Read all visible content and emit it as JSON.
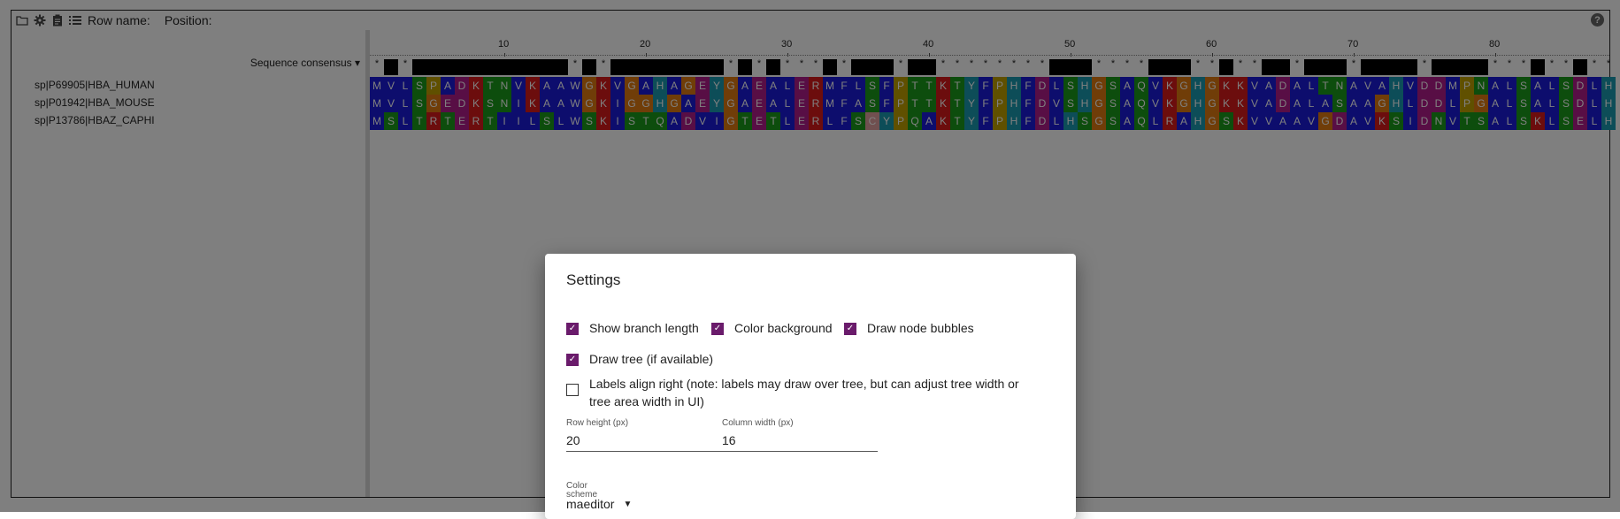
{
  "toolbar": {
    "icons": [
      "folder-icon",
      "gear-icon",
      "clipboard-icon",
      "list-icon"
    ],
    "row_name_label": "Row name:",
    "position_label": "Position:",
    "help": "?"
  },
  "alignment": {
    "consensus_label": "Sequence consensus",
    "ruler_ticks": [
      "10",
      "20",
      "30",
      "40",
      "50",
      "60",
      "70",
      "80"
    ],
    "row_names": [
      "sp|P69905|HBA_HUMAN",
      "sp|P01942|HBA_MOUSE",
      "sp|P13786|HBAZ_CAPHI"
    ],
    "sequences": [
      "MVLSPADKTNVKAAWGKVGAHAGEYGAEALERMFLSFPTTKTYFPHFDLSHGSAQVKGHGKKVADALTNAVAHVDDMPNALSALSDLH",
      "MVLSGEDKSNIKAAWGKIGGHGAEYGAEALERMFASFPTTKTYFPHFDVSHGSAQVKGHGKKVADALASAAGHLDDLPGALSALSDLH",
      "MSLTRTERTIILSLWSKISTQADVIGTETLERLFSCYPQAKTYFPHFDLHSGSAQLRAHGSKVVAAVGDAVKSIDNVTSALSKLSELH"
    ],
    "colors": {
      "hydrophobic": "#1a1adb",
      "positive": "#d91a1a",
      "negative": "#b01d8a",
      "polar": "#1a9a1a",
      "cys": "#e0a0a0",
      "gly": "#e07a10",
      "pro": "#c0a000",
      "aromatic": "#1a9ab0",
      "his": "#1aa0a0",
      "consensus_dark": "#000000"
    }
  },
  "settings": {
    "title": "Settings",
    "checkboxes": [
      {
        "label": "Show branch length",
        "checked": true
      },
      {
        "label": "Color background",
        "checked": true
      },
      {
        "label": "Draw node bubbles",
        "checked": true
      },
      {
        "label": "Draw tree (if available)",
        "checked": true
      },
      {
        "label": "Labels align right (note: labels may draw over tree, but can adjust tree width or tree area width in UI)",
        "checked": false
      }
    ],
    "row_height_label": "Row height (px)",
    "row_height_value": "20",
    "column_width_label": "Column width (px)",
    "column_width_value": "16",
    "color_scheme_label": "Color scheme",
    "color_scheme_value": "maeditor",
    "accent": "#6a1b6b"
  }
}
